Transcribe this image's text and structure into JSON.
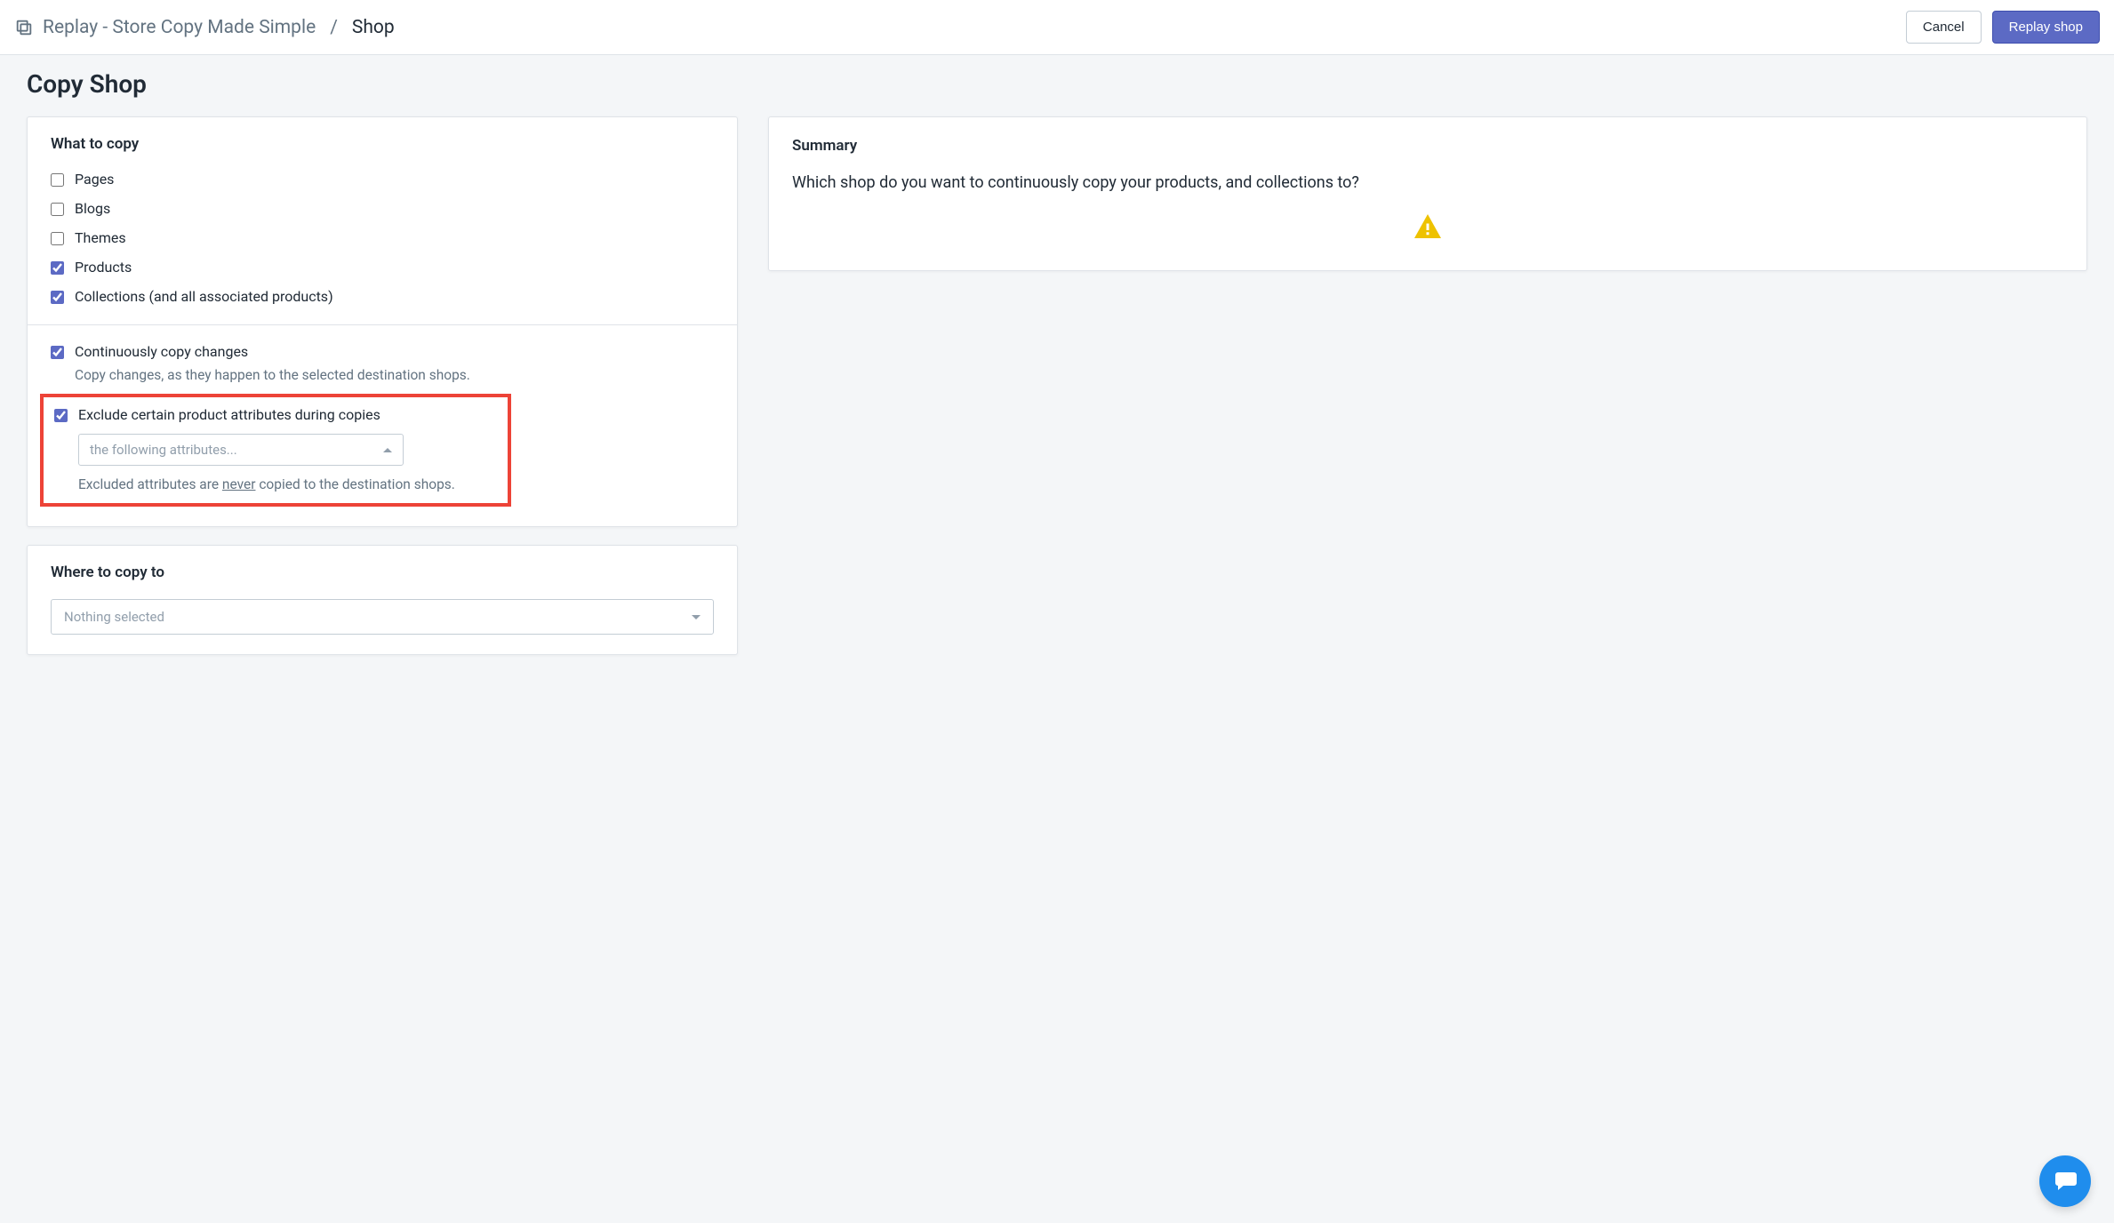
{
  "breadcrumb": {
    "app_name": "Replay - Store Copy Made Simple",
    "separator": "/",
    "current": "Shop"
  },
  "header_actions": {
    "cancel": "Cancel",
    "primary": "Replay shop"
  },
  "page_title": "Copy Shop",
  "what_to_copy": {
    "heading": "What to copy",
    "items": [
      {
        "label": "Pages",
        "checked": false
      },
      {
        "label": "Blogs",
        "checked": false
      },
      {
        "label": "Themes",
        "checked": false
      },
      {
        "label": "Products",
        "checked": true
      },
      {
        "label": "Collections (and all associated products)",
        "checked": true
      }
    ]
  },
  "continuous": {
    "label": "Continuously copy changes",
    "checked": true,
    "help": "Copy changes, as they happen to the selected destination shops."
  },
  "exclude": {
    "label": "Exclude certain product attributes during copies",
    "checked": true,
    "placeholder": "the following attributes...",
    "note_pre": "Excluded attributes are ",
    "note_underline": "never",
    "note_post": " copied to the destination shops."
  },
  "where_to_copy": {
    "heading": "Where to copy to",
    "placeholder": "Nothing selected"
  },
  "summary": {
    "heading": "Summary",
    "text": "Which shop do you want to continuously copy your products, and collections to?"
  }
}
